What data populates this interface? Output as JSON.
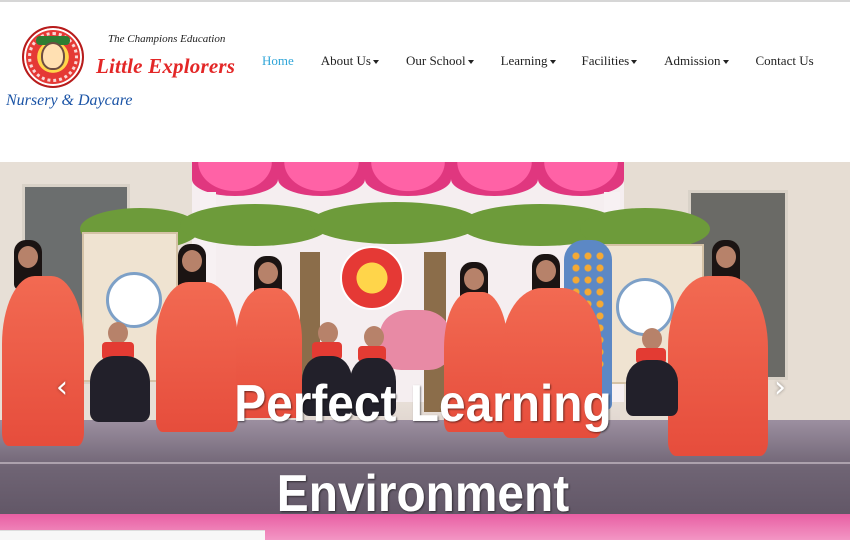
{
  "header": {
    "tagline": "The Champions Education",
    "brand": "Little Explorers",
    "subbrand": "Nursery & Daycare",
    "logo_icon": "school-emblem-icon"
  },
  "nav": {
    "items": [
      {
        "label": "Home",
        "active": true,
        "dropdown": false
      },
      {
        "label": "About Us",
        "active": false,
        "dropdown": true
      },
      {
        "label": "Our School",
        "active": false,
        "dropdown": true
      },
      {
        "label": "Learning",
        "active": false,
        "dropdown": true
      },
      {
        "label": "Facilities",
        "active": false,
        "dropdown": true
      },
      {
        "label": "Admission",
        "active": false,
        "dropdown": true
      },
      {
        "label": "Contact Us",
        "active": false,
        "dropdown": false
      }
    ],
    "active_color": "#31a6d8"
  },
  "hero": {
    "caption_line1": "Perfect Learning",
    "caption_line2": "Environment",
    "prev_icon": "chevron-left-icon",
    "next_icon": "chevron-right-icon",
    "prev_glyph": "‹",
    "next_glyph": "›"
  },
  "colors": {
    "brand_red": "#e32727",
    "subbrand_blue": "#1b54a6",
    "curtain_pink": "#ff62a6"
  }
}
